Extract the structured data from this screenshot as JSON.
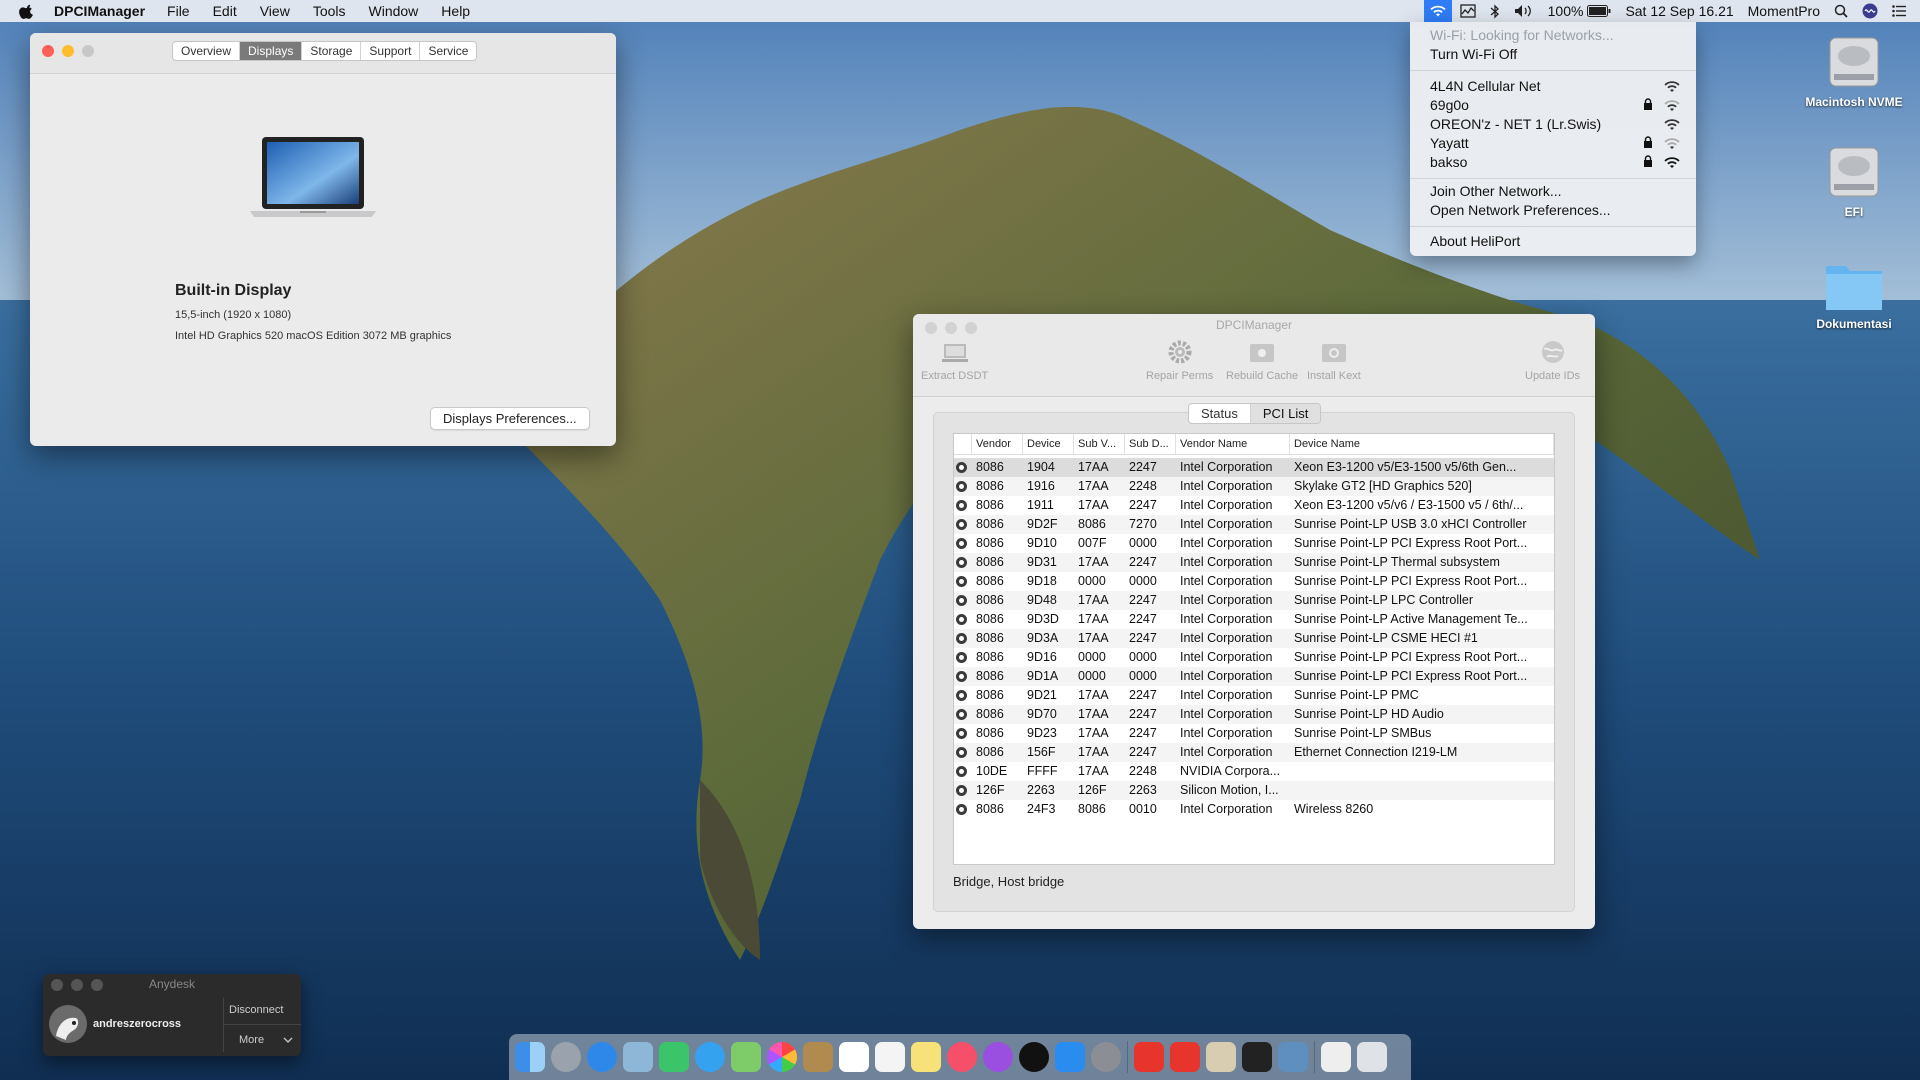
{
  "menubar": {
    "app_name": "DPCIManager",
    "menus": [
      "File",
      "Edit",
      "View",
      "Tools",
      "Window",
      "Help"
    ],
    "battery": "100%",
    "datetime": "Sat 12 Sep  16.21",
    "user": "MomentPro"
  },
  "wifi_menu": {
    "status": "Wi-Fi: Looking for Networks...",
    "toggle": "Turn Wi-Fi Off",
    "networks": [
      {
        "name": "4L4N Cellular Net",
        "locked": false
      },
      {
        "name": "69g0o",
        "locked": true
      },
      {
        "name": "OREON'z - NET 1 (Lr.Swis)",
        "locked": false
      },
      {
        "name": "Yayatt",
        "locked": true
      },
      {
        "name": "bakso",
        "locked": true
      }
    ],
    "join_other": "Join Other Network...",
    "open_prefs": "Open Network Preferences...",
    "about": "About HeliPort"
  },
  "about_window": {
    "tabs": [
      "Overview",
      "Displays",
      "Storage",
      "Support",
      "Service"
    ],
    "selected_tab": "Displays",
    "display_title": "Built-in Display",
    "display_size": "15,5-inch (1920 x 1080)",
    "display_gpu": "Intel HD Graphics 520 macOS Edition 3072 MB graphics",
    "prefs_button": "Displays Preferences..."
  },
  "dpci_window": {
    "title": "DPCIManager",
    "toolbar": {
      "extract": "Extract DSDT",
      "repair": "Repair Perms",
      "rebuild": "Rebuild Cache",
      "install": "Install Kext",
      "update": "Update IDs"
    },
    "tabs": [
      "Status",
      "PCI List"
    ],
    "selected_tab": "PCI List",
    "columns": [
      "Vendor",
      "Device",
      "Sub V...",
      "Sub D...",
      "Vendor Name",
      "Device Name"
    ],
    "rows": [
      [
        "8086",
        "1904",
        "17AA",
        "2247",
        "Intel Corporation",
        "Xeon E3-1200 v5/E3-1500 v5/6th Gen..."
      ],
      [
        "8086",
        "1916",
        "17AA",
        "2248",
        "Intel Corporation",
        "Skylake GT2 [HD Graphics 520]"
      ],
      [
        "8086",
        "1911",
        "17AA",
        "2247",
        "Intel Corporation",
        "Xeon E3-1200 v5/v6 / E3-1500 v5 / 6th/..."
      ],
      [
        "8086",
        "9D2F",
        "8086",
        "7270",
        "Intel Corporation",
        "Sunrise Point-LP USB 3.0 xHCI Controller"
      ],
      [
        "8086",
        "9D10",
        "007F",
        "0000",
        "Intel Corporation",
        "Sunrise Point-LP PCI Express Root Port..."
      ],
      [
        "8086",
        "9D31",
        "17AA",
        "2247",
        "Intel Corporation",
        "Sunrise Point-LP Thermal subsystem"
      ],
      [
        "8086",
        "9D18",
        "0000",
        "0000",
        "Intel Corporation",
        "Sunrise Point-LP PCI Express Root Port..."
      ],
      [
        "8086",
        "9D48",
        "17AA",
        "2247",
        "Intel Corporation",
        "Sunrise Point-LP LPC Controller"
      ],
      [
        "8086",
        "9D3D",
        "17AA",
        "2247",
        "Intel Corporation",
        "Sunrise Point-LP Active Management Te..."
      ],
      [
        "8086",
        "9D3A",
        "17AA",
        "2247",
        "Intel Corporation",
        "Sunrise Point-LP CSME HECI #1"
      ],
      [
        "8086",
        "9D16",
        "0000",
        "0000",
        "Intel Corporation",
        "Sunrise Point-LP PCI Express Root Port..."
      ],
      [
        "8086",
        "9D1A",
        "0000",
        "0000",
        "Intel Corporation",
        "Sunrise Point-LP PCI Express Root Port..."
      ],
      [
        "8086",
        "9D21",
        "17AA",
        "2247",
        "Intel Corporation",
        "Sunrise Point-LP PMC"
      ],
      [
        "8086",
        "9D70",
        "17AA",
        "2247",
        "Intel Corporation",
        "Sunrise Point-LP HD Audio"
      ],
      [
        "8086",
        "9D23",
        "17AA",
        "2247",
        "Intel Corporation",
        "Sunrise Point-LP SMBus"
      ],
      [
        "8086",
        "156F",
        "17AA",
        "2247",
        "Intel Corporation",
        "Ethernet Connection I219-LM"
      ],
      [
        "10DE",
        "FFFF",
        "17AA",
        "2248",
        "NVIDIA Corpora...",
        ""
      ],
      [
        "126F",
        "2263",
        "126F",
        "2263",
        "Silicon Motion, I...",
        ""
      ],
      [
        "8086",
        "24F3",
        "8086",
        "0010",
        "Intel Corporation",
        "Wireless 8260"
      ]
    ],
    "status_text": "Bridge, Host bridge"
  },
  "desktop_icons": [
    "Macintosh NVME",
    "EFI",
    "Dokumentasi"
  ],
  "anydesk": {
    "title": "Anydesk",
    "user": "andreszerocross",
    "disconnect": "Disconnect",
    "more": "More"
  },
  "colors": {
    "accent": "#2f7cf6",
    "close": "#fe5f57",
    "minimize": "#febc2e",
    "zoom": "#28c840"
  }
}
